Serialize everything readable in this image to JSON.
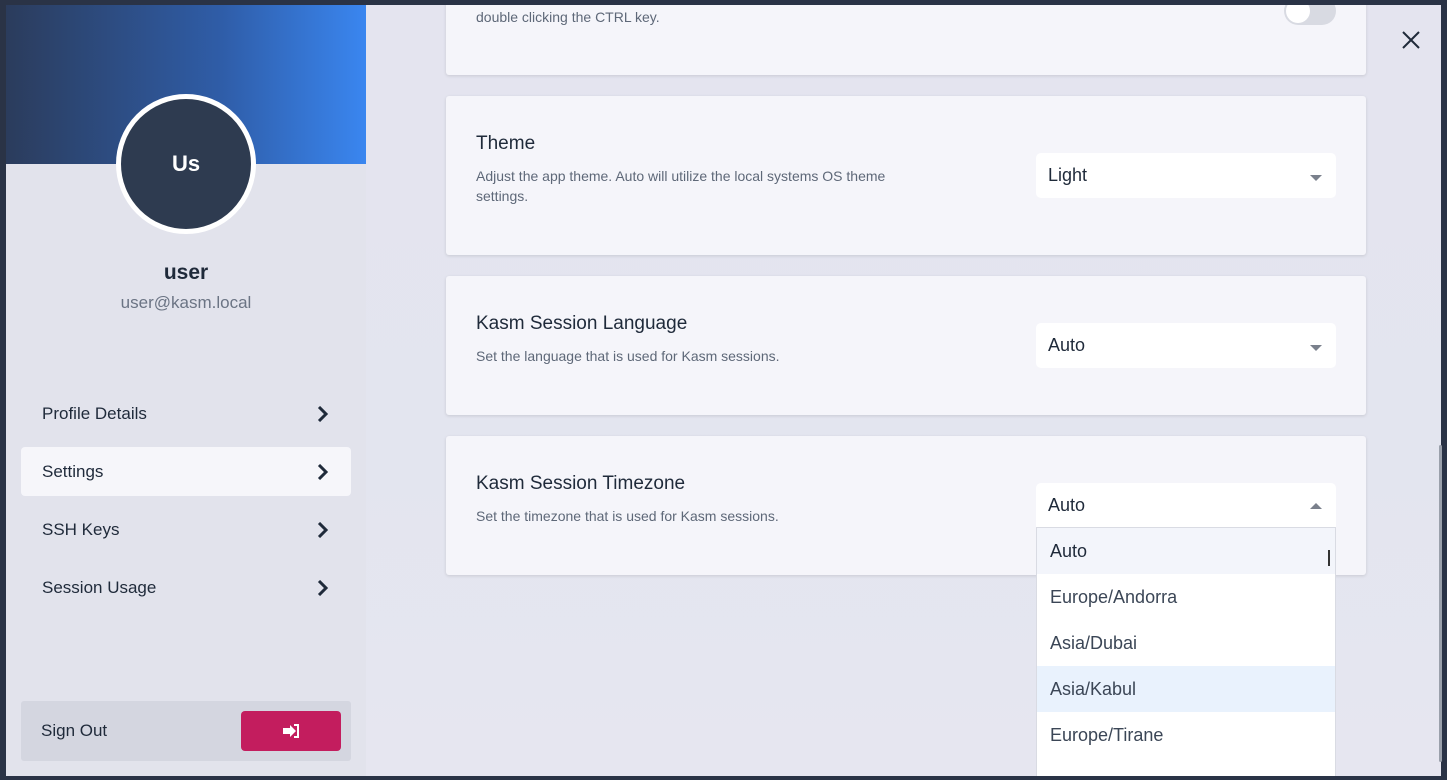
{
  "user": {
    "initials": "Us",
    "name": "user",
    "email": "user@kasm.local"
  },
  "nav": {
    "items": [
      {
        "label": "Profile Details"
      },
      {
        "label": "Settings",
        "active": true
      },
      {
        "label": "SSH Keys"
      },
      {
        "label": "Session Usage"
      }
    ]
  },
  "signout": {
    "label": "Sign Out"
  },
  "settings": {
    "partial_card": {
      "desc": "double clicking the CTRL key."
    },
    "theme": {
      "title": "Theme",
      "desc": "Adjust the app theme. Auto will utilize the local systems OS theme settings.",
      "value": "Light"
    },
    "language": {
      "title": "Kasm Session Language",
      "desc": "Set the language that is used for Kasm sessions.",
      "value": "Auto"
    },
    "timezone": {
      "title": "Kasm Session Timezone",
      "desc": "Set the timezone that is used for Kasm sessions.",
      "value": "Auto",
      "options": [
        "Auto",
        "Europe/Andorra",
        "Asia/Dubai",
        "Asia/Kabul",
        "Europe/Tirane"
      ],
      "highlighted": "Asia/Kabul"
    }
  },
  "icons": {
    "close": "close-icon",
    "chevron": "chevron-right-icon",
    "signout": "sign-out-icon",
    "caret": "caret-down-icon"
  },
  "colors": {
    "accent": "#c31d5e",
    "banner_from": "#2b3c5c",
    "banner_to": "#3a86f0"
  }
}
